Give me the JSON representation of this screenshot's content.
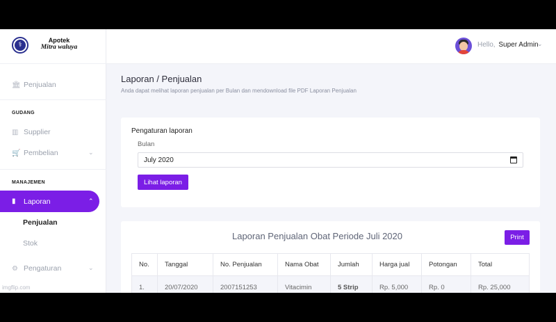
{
  "brand": {
    "title": "Apotek",
    "subtitle": "Mitra waluya"
  },
  "sidebar": {
    "item_penjualan": "Penjualan",
    "section_gudang": "GUDANG",
    "item_supplier": "Supplier",
    "item_pembelian": "Pembelian",
    "section_manajemen": "MANAJEMEN",
    "item_laporan": "Laporan",
    "sub_penjualan": "Penjualan",
    "sub_stok": "Stok",
    "item_pengaturan": "Pengaturan"
  },
  "topbar": {
    "greeting": "Hello,",
    "user": "Super Admin"
  },
  "page": {
    "title": "Laporan / Penjualan",
    "description": "Anda dapat melihat laporan penjualan per Bulan dan mendownload file PDF Laporan Penjualan"
  },
  "settings": {
    "title": "Pengaturan laporan",
    "month_label": "Bulan",
    "month_value": "July 2020",
    "view_button": "Lihat laporan"
  },
  "report": {
    "title": "Laporan Penjualan Obat Periode Juli 2020",
    "print_button": "Print",
    "columns": [
      "No.",
      "Tanggal",
      "No. Penjualan",
      "Nama Obat",
      "Jumlah",
      "Harga jual",
      "Potongan",
      "Total"
    ],
    "rows": [
      [
        "1.",
        "20/07/2020",
        "2007151253",
        "Vitacimin",
        "5 Strip",
        "Rp. 5,000",
        "Rp. 0",
        "Rp. 25,000"
      ]
    ]
  },
  "watermark": "imgflip.com",
  "colors": {
    "accent": "#7b1ee6",
    "background": "#f4f5fa"
  },
  "icons": {
    "penjualan": "bank-icon",
    "supplier": "warehouse-icon",
    "pembelian": "cart-icon",
    "laporan": "clipboard-icon",
    "pengaturan": "gears-icon"
  }
}
